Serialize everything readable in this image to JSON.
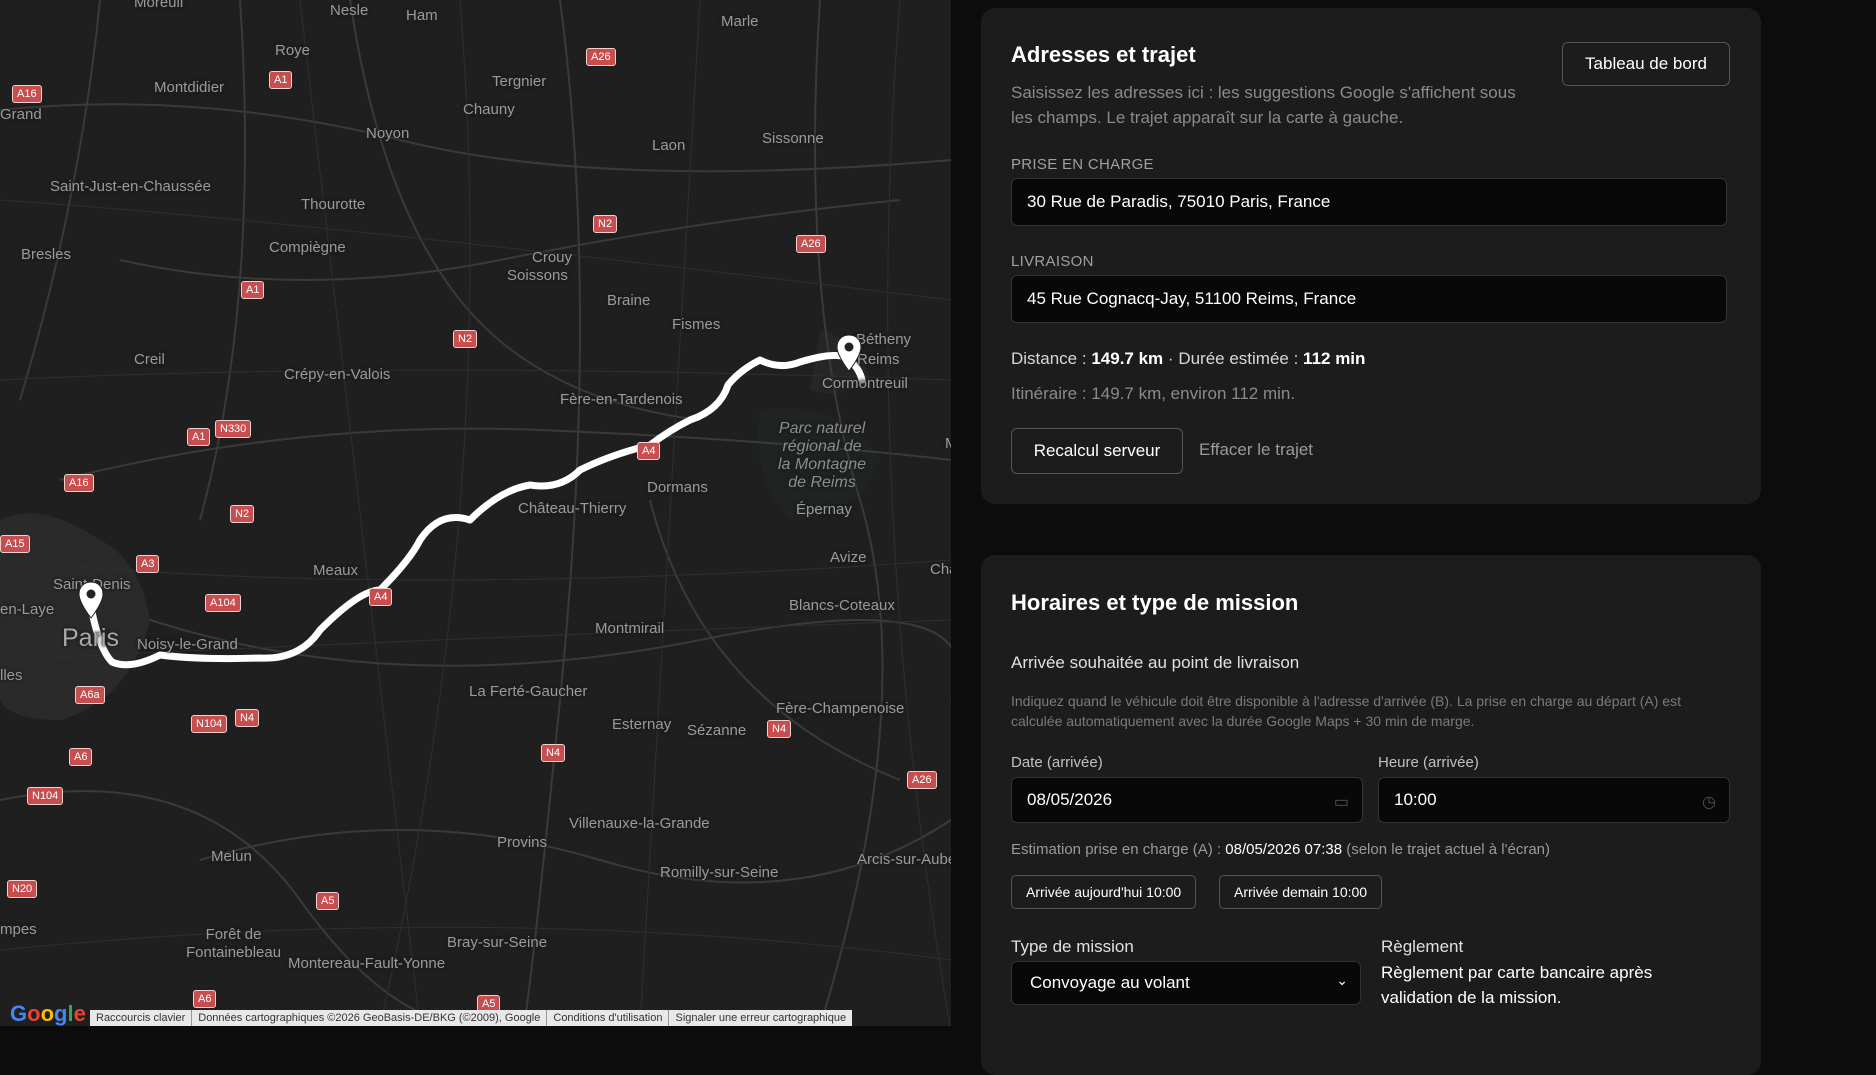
{
  "map": {
    "places": [
      {
        "id": "nesle",
        "text": "Nesle"
      },
      {
        "id": "ham",
        "text": "Ham"
      },
      {
        "id": "marle",
        "text": "Marle"
      },
      {
        "id": "roye",
        "text": "Roye"
      },
      {
        "id": "montdidier",
        "text": "Montdidier"
      },
      {
        "id": "tergnier",
        "text": "Tergnier"
      },
      {
        "id": "chauny",
        "text": "Chauny"
      },
      {
        "id": "noyon",
        "text": "Noyon"
      },
      {
        "id": "laon",
        "text": "Laon"
      },
      {
        "id": "sissonne",
        "text": "Sissonne"
      },
      {
        "id": "saint-just",
        "text": "Saint-Just-en-Chaussée"
      },
      {
        "id": "thourotte",
        "text": "Thourotte"
      },
      {
        "id": "compiegne",
        "text": "Compiègne"
      },
      {
        "id": "crouy",
        "text": "Crouy"
      },
      {
        "id": "soissons",
        "text": "Soissons"
      },
      {
        "id": "bresles",
        "text": "Bresles"
      },
      {
        "id": "braine",
        "text": "Braine"
      },
      {
        "id": "fismes",
        "text": "Fismes"
      },
      {
        "id": "bethenny",
        "text": "Bétheny"
      },
      {
        "id": "reims",
        "text": "Reims"
      },
      {
        "id": "cormontreuil",
        "text": "Cormontreuil"
      },
      {
        "id": "creil",
        "text": "Creil"
      },
      {
        "id": "crepy",
        "text": "Crépy-en-Valois"
      },
      {
        "id": "fere-tardenois",
        "text": "Fère-en-Tardenois"
      },
      {
        "id": "dormans",
        "text": "Dormans"
      },
      {
        "id": "chateau-thierry",
        "text": "Château-Thierry"
      },
      {
        "id": "epernay",
        "text": "Épernay"
      },
      {
        "id": "avize",
        "text": "Avize"
      },
      {
        "id": "saint-denis",
        "text": "Saint-Denis"
      },
      {
        "id": "meaux",
        "text": "Meaux"
      },
      {
        "id": "blancs-coteaux",
        "text": "Blancs-Coteaux"
      },
      {
        "id": "paris",
        "text": "Paris"
      },
      {
        "id": "noisy",
        "text": "Noisy-le-Grand"
      },
      {
        "id": "montmirail",
        "text": "Montmirail"
      },
      {
        "id": "ferte-gaucher",
        "text": "La Ferté-Gaucher"
      },
      {
        "id": "fere-champenoise",
        "text": "Fère-Champenoise"
      },
      {
        "id": "esternay",
        "text": "Esternay"
      },
      {
        "id": "sezanne",
        "text": "Sézanne"
      },
      {
        "id": "villenauxe",
        "text": "Villenauxe-la-Grande"
      },
      {
        "id": "provins",
        "text": "Provins"
      },
      {
        "id": "melun",
        "text": "Melun"
      },
      {
        "id": "arcis",
        "text": "Arcis-sur-Aube"
      },
      {
        "id": "romilly",
        "text": "Romilly-sur-Seine"
      },
      {
        "id": "bray",
        "text": "Bray-sur-Seine"
      },
      {
        "id": "fontainebleau",
        "text": "Forêt de\nFontainebleau"
      },
      {
        "id": "montereau",
        "text": "Montereau-Fault-Yonne"
      },
      {
        "id": "moreuil",
        "text": "Moreuil"
      },
      {
        "id": "grand",
        "text": "Grand"
      },
      {
        "id": "en-laye",
        "text": "en-Laye"
      },
      {
        "id": "lles",
        "text": "lles"
      },
      {
        "id": "mpes",
        "text": "mpes"
      },
      {
        "id": "cha",
        "text": "Cha"
      },
      {
        "id": "m",
        "text": "M"
      }
    ],
    "park": "Parc naturel\nrégional de\nla Montagne\nde Reims",
    "shields": [
      {
        "id": "a26-top",
        "text": "A26"
      },
      {
        "id": "a16-top",
        "text": "A16"
      },
      {
        "id": "a1-top",
        "text": "A1"
      },
      {
        "id": "n2-a",
        "text": "N2"
      },
      {
        "id": "a26-mid",
        "text": "A26"
      },
      {
        "id": "a1-mid",
        "text": "A1"
      },
      {
        "id": "n2-b",
        "text": "N2"
      },
      {
        "id": "a1-low",
        "text": "A1"
      },
      {
        "id": "n330",
        "text": "N330"
      },
      {
        "id": "a4-a",
        "text": "A4"
      },
      {
        "id": "a16-low",
        "text": "A16"
      },
      {
        "id": "n2-c",
        "text": "N2"
      },
      {
        "id": "a15",
        "text": "A15"
      },
      {
        "id": "a3",
        "text": "A3"
      },
      {
        "id": "a104",
        "text": "A104"
      },
      {
        "id": "a4-b",
        "text": "A4"
      },
      {
        "id": "a6a",
        "text": "A6a"
      },
      {
        "id": "n104-a",
        "text": "N104"
      },
      {
        "id": "n4-a",
        "text": "N4"
      },
      {
        "id": "a6-a",
        "text": "A6"
      },
      {
        "id": "n4-b",
        "text": "N4"
      },
      {
        "id": "n4-c",
        "text": "N4"
      },
      {
        "id": "n104-b",
        "text": "N104"
      },
      {
        "id": "a26-low",
        "text": "A26"
      },
      {
        "id": "n20",
        "text": "N20"
      },
      {
        "id": "a5-a",
        "text": "A5"
      },
      {
        "id": "a6-b",
        "text": "A6"
      },
      {
        "id": "a5-b",
        "text": "A5"
      }
    ],
    "logo": "Google",
    "attribution": [
      "Raccourcis clavier",
      "Données cartographiques ©2026 GeoBasis-DE/BKG (©2009), Google",
      "Conditions d'utilisation",
      "Signaler une erreur cartographique"
    ]
  },
  "address_card": {
    "title": "Adresses et trajet",
    "dashboard_button": "Tableau de bord",
    "description": "Saisissez les adresses ici : les suggestions Google s'affichent sous les champs. Le trajet apparaît sur la carte à gauche.",
    "pickup_label": "PRISE EN CHARGE",
    "pickup_value": "30 Rue de Paradis, 75010 Paris, France",
    "delivery_label": "LIVRAISON",
    "delivery_value": "45 Rue Cognacq-Jay, 51100 Reims, France",
    "distance_label": "Distance :",
    "distance_value": "149.7 km",
    "separator": "·",
    "duration_label": "Durée estimée :",
    "duration_value": "112 min",
    "itinerary": "Itinéraire : 149.7 km, environ 112 min.",
    "recalc_button": "Recalcul serveur",
    "clear_link": "Effacer le trajet"
  },
  "schedule_card": {
    "title": "Horaires et type de mission",
    "arrival_heading": "Arrivée souhaitée au point de livraison",
    "arrival_help": "Indiquez quand le véhicule doit être disponible à l'adresse d'arrivée (B). La prise en charge au départ (A) est calculée automatiquement avec la durée Google Maps + 30 min de marge.",
    "date_label": "Date (arrivée)",
    "date_value": "08/05/2026",
    "time_label": "Heure (arrivée)",
    "time_value": "10:00",
    "estimate_prefix": "Estimation prise en charge (A) :",
    "estimate_value": "08/05/2026 07:38",
    "estimate_suffix": "(selon le trajet actuel à l'écran)",
    "today_button": "Arrivée aujourd'hui 10:00",
    "tomorrow_button": "Arrivée demain 10:00",
    "mission_type_label": "Type de mission",
    "mission_type_value": "Convoyage au volant",
    "payment_label": "Règlement",
    "payment_text": "Règlement par carte bancaire après validation de la mission."
  },
  "colors": {
    "map_bg": "#1f1f1f",
    "route": "#ffffff",
    "shield": "#c74e4e",
    "card_bg": "#1c1c1c",
    "page_bg": "#0c0c0c"
  }
}
